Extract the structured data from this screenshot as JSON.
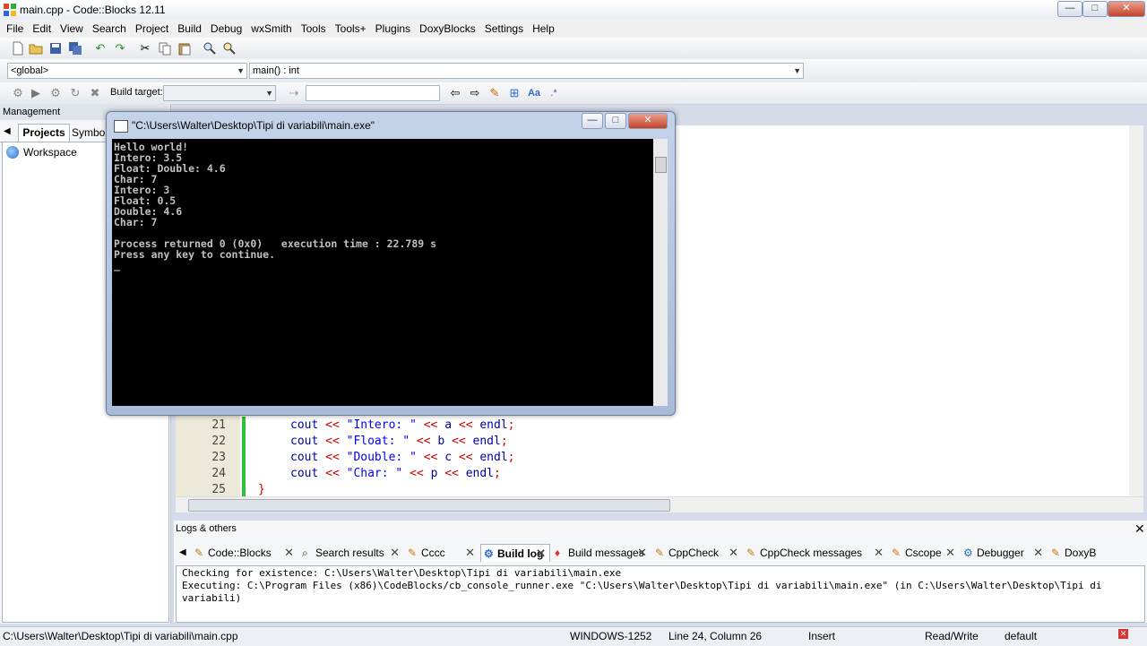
{
  "window": {
    "title": "main.cpp - Code::Blocks 12.11",
    "controls": {
      "minimize": "—",
      "maximize": "□",
      "close": "✕"
    }
  },
  "menu": [
    "File",
    "Edit",
    "View",
    "Search",
    "Project",
    "Build",
    "Debug",
    "wxSmith",
    "Tools",
    "Tools+",
    "Plugins",
    "DoxyBlocks",
    "Settings",
    "Help"
  ],
  "code_toolbar": {
    "scope": "<global>",
    "function": "main() : int"
  },
  "compiler_toolbar": {
    "build_target_label": "Build target:",
    "build_target_value": "",
    "search_value": ""
  },
  "management": {
    "title": "Management",
    "tabs": [
      "Projects",
      "Symbol"
    ],
    "tree": [
      {
        "label": "Workspace",
        "icon": "workspace-icon"
      }
    ]
  },
  "editor": {
    "lines": [
      {
        "num": "21",
        "parts": [
          [
            "kw",
            "cout"
          ],
          [
            "op",
            " << "
          ],
          [
            "str",
            "\"Intero: \""
          ],
          [
            "op",
            " << "
          ],
          [
            "kw",
            "a"
          ],
          [
            "op",
            " << "
          ],
          [
            "kw",
            "endl"
          ],
          [
            "op",
            ";"
          ]
        ]
      },
      {
        "num": "22",
        "parts": [
          [
            "kw",
            "cout"
          ],
          [
            "op",
            " << "
          ],
          [
            "str",
            "\"Float: \""
          ],
          [
            "op",
            " << "
          ],
          [
            "kw",
            "b"
          ],
          [
            "op",
            " << "
          ],
          [
            "kw",
            "endl"
          ],
          [
            "op",
            ";"
          ]
        ]
      },
      {
        "num": "23",
        "parts": [
          [
            "kw",
            "cout"
          ],
          [
            "op",
            " << "
          ],
          [
            "str",
            "\"Double: \""
          ],
          [
            "op",
            " << "
          ],
          [
            "kw",
            "c"
          ],
          [
            "op",
            " << "
          ],
          [
            "kw",
            "endl"
          ],
          [
            "op",
            ";"
          ]
        ]
      },
      {
        "num": "24",
        "parts": [
          [
            "kw",
            "cout"
          ],
          [
            "op",
            " << "
          ],
          [
            "str",
            "\"Char: \""
          ],
          [
            "op",
            " << "
          ],
          [
            "kw",
            "p"
          ],
          [
            "op",
            " << "
          ],
          [
            "kw",
            "endl"
          ],
          [
            "op",
            ";"
          ]
        ]
      },
      {
        "num": "25",
        "parts": [
          [
            "op",
            "}"
          ]
        ]
      }
    ]
  },
  "console": {
    "title": "\"C:\\Users\\Walter\\Desktop\\Tipi di variabili\\main.exe\"",
    "lines": [
      "Hello world!",
      "Intero: 3.5",
      "Float: Double: 4.6",
      "Char: 7",
      "Intero: 3",
      "Float: 0.5",
      "Double: 4.6",
      "Char: 7",
      "",
      "Process returned 0 (0x0)   execution time : 22.789 s",
      "Press any key to continue.",
      "_"
    ]
  },
  "logs": {
    "title": "Logs & others",
    "tabs": [
      {
        "label": "Code::Blocks",
        "icon": "pencil-icon",
        "active": false
      },
      {
        "label": "Search results",
        "icon": "magnifier-icon",
        "active": false
      },
      {
        "label": "Cccc",
        "icon": "pencil-icon",
        "active": false
      },
      {
        "label": "Build log",
        "icon": "gear-icon",
        "active": true
      },
      {
        "label": "Build messages",
        "icon": "build-messages-icon",
        "active": false
      },
      {
        "label": "CppCheck",
        "icon": "pencil-icon",
        "active": false
      },
      {
        "label": "CppCheck messages",
        "icon": "pencil-icon",
        "active": false
      },
      {
        "label": "Cscope",
        "icon": "pencil-icon",
        "active": false
      },
      {
        "label": "Debugger",
        "icon": "gear-icon",
        "active": false
      },
      {
        "label": "DoxyB",
        "icon": "pencil-icon",
        "active": false
      }
    ],
    "lines": [
      "Checking for existence: C:\\Users\\Walter\\Desktop\\Tipi di variabili\\main.exe",
      "Executing: C:\\Program Files (x86)\\CodeBlocks/cb_console_runner.exe \"C:\\Users\\Walter\\Desktop\\Tipi di variabili\\main.exe\" (in C:\\Users\\Walter\\Desktop\\Tipi di",
      "variabili)"
    ]
  },
  "status": {
    "path": "C:\\Users\\Walter\\Desktop\\Tipi di variabili\\main.cpp",
    "encoding": "WINDOWS-1252",
    "position": "Line 24, Column 26",
    "mode": "Insert",
    "access": "Read/Write",
    "lexer": "default"
  }
}
